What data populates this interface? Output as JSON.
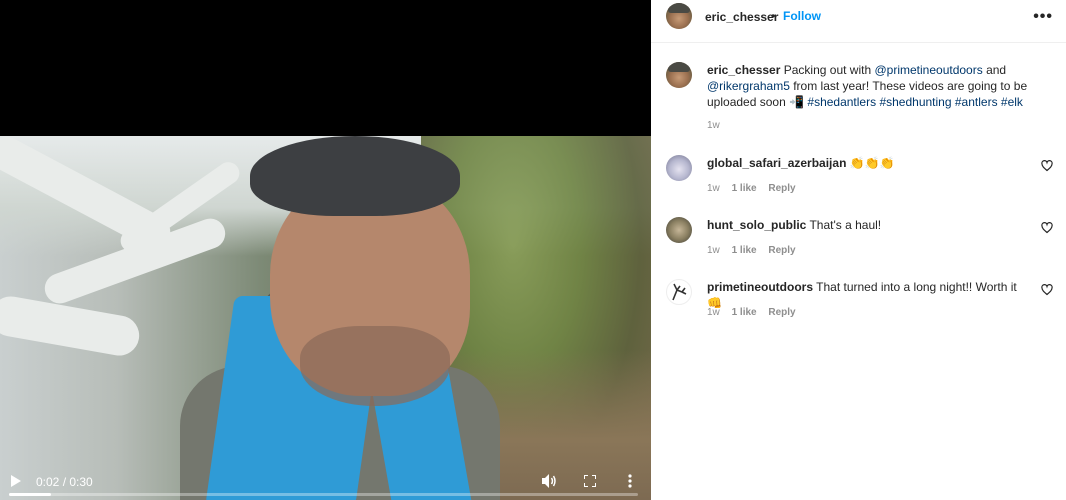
{
  "video": {
    "time": "0:02 / 0:30",
    "progress": 0.067,
    "icons": [
      "play-icon",
      "volume-icon",
      "fullscreen-icon",
      "more-vertical-icon"
    ]
  },
  "header": {
    "username": "eric_chesser",
    "separator": "•",
    "follow": "Follow",
    "more": "•••"
  },
  "caption": {
    "username": "eric_chesser",
    "text_1": "Packing out with",
    "mention_1": "@primetineoutdoors",
    "text_2": "and",
    "mention_2": "@rikergraham5",
    "text_3": "from last year! These videos are going to be uploaded soon",
    "emoji": "📲",
    "hashtags": [
      "#shedantlers",
      "#shedhunting",
      "#antlers",
      "#elk"
    ],
    "time": "1w"
  },
  "comments": [
    {
      "username": "global_safari_azerbaijan",
      "text": "👏👏👏",
      "time": "1w",
      "likes": "1 like",
      "reply": "Reply"
    },
    {
      "username": "hunt_solo_public",
      "text": "That's a haul!",
      "time": "1w",
      "likes": "1 like",
      "reply": "Reply"
    },
    {
      "username": "primetineoutdoors",
      "text": "That turned into a long night!! Worth it",
      "emoji": "👊",
      "time": "1w",
      "likes": "1 like",
      "reply": "Reply"
    }
  ],
  "colors": {
    "link": "#00376b",
    "follow": "#0095f6",
    "meta": "#8e8e8e"
  }
}
